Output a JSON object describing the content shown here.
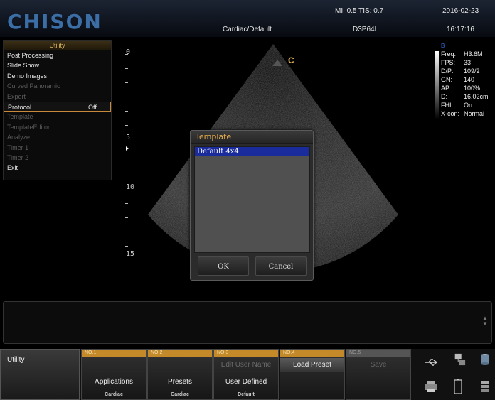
{
  "header": {
    "logo": "CHISON",
    "preset_path": "Cardiac/Default",
    "mi_tis": "MI: 0.5 TIS: 0.7",
    "probe": "D3P64L",
    "date": "2016-02-23",
    "time": "16:17:16"
  },
  "menu": {
    "title": "Utility",
    "items": [
      {
        "label": "Post Processing",
        "enabled": true
      },
      {
        "label": "Slide Show",
        "enabled": true
      },
      {
        "label": "Demo Images",
        "enabled": true
      },
      {
        "label": "Curved Panoramic",
        "enabled": false
      },
      {
        "label": "Export",
        "enabled": false
      },
      {
        "label": "Protocol",
        "enabled": true,
        "value": "Off",
        "selected": true
      },
      {
        "label": "Template",
        "enabled": false
      },
      {
        "label": "TemplateEditor",
        "enabled": false
      },
      {
        "label": "Analyze",
        "enabled": false
      },
      {
        "label": "Timer 1",
        "enabled": false
      },
      {
        "label": "Timer 2",
        "enabled": false
      },
      {
        "label": "Exit",
        "enabled": true
      }
    ]
  },
  "image": {
    "orientation_mark": "C",
    "depth_labels": [
      "0",
      "5",
      "10",
      "15"
    ]
  },
  "params": {
    "mode": "B",
    "rows": [
      {
        "label": "Freq:",
        "value": "H3.6M"
      },
      {
        "label": "FPS:",
        "value": "33"
      },
      {
        "label": "D/P:",
        "value": "109/2"
      },
      {
        "label": "GN:",
        "value": "140"
      },
      {
        "label": "AP:",
        "value": "100%"
      },
      {
        "label": "D:",
        "value": "16.02cm"
      },
      {
        "label": "FHI:",
        "value": "On"
      },
      {
        "label": "X-con:",
        "value": "Normal"
      }
    ]
  },
  "dialog": {
    "title": "Template",
    "items": [
      "Default 4x4"
    ],
    "ok_label": "OK",
    "cancel_label": "Cancel"
  },
  "bottom": {
    "utility_label": "Utility",
    "slots": [
      {
        "no": "NO.1",
        "top": "",
        "mid": "Applications",
        "sub": "Cardiac"
      },
      {
        "no": "NO.2",
        "top": "",
        "mid": "Presets",
        "sub": "Cardiac"
      },
      {
        "no": "NO.3",
        "top": "Edit User Name",
        "mid": "User Defined",
        "sub": "Default"
      },
      {
        "no": "NO.4",
        "top": "Load Preset",
        "mid": "",
        "sub": ""
      },
      {
        "no": "NO.5",
        "top": "Save",
        "mid": "",
        "sub": ""
      }
    ],
    "icons": [
      "usb-icon",
      "network-icon",
      "disk-icon",
      "printer-icon",
      "battery-icon",
      "storage-icon"
    ]
  },
  "colors": {
    "accent": "#c48a2a",
    "logo": "#3b6ea5",
    "selection": "#1a2b9c"
  }
}
